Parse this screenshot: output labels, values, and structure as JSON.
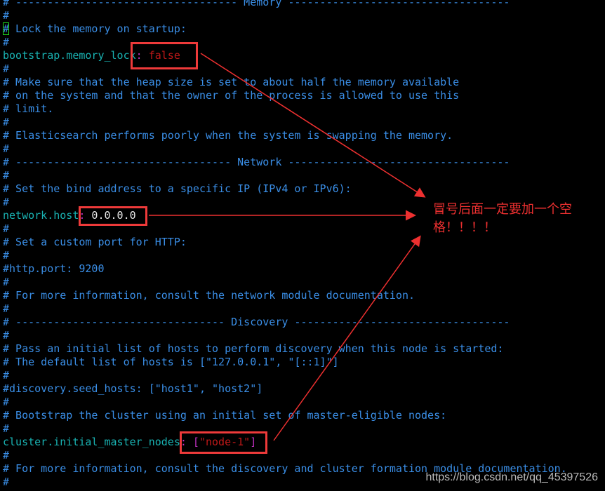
{
  "lines": [
    [
      [
        "c",
        "# ----------------------------------- Memory -----------------------------------"
      ]
    ],
    [
      [
        "c",
        "#"
      ]
    ],
    [
      [
        "c cursor",
        "#"
      ],
      [
        "c",
        " Lock the memory on startup:"
      ]
    ],
    [
      [
        "c",
        "#"
      ]
    ],
    [
      [
        "k",
        "bootstrap.memory_lock"
      ],
      [
        "p",
        ":"
      ],
      [
        "s",
        " false"
      ]
    ],
    [
      [
        "c",
        "#"
      ]
    ],
    [
      [
        "c",
        "# Make sure that the heap size is set to about half the memory available"
      ]
    ],
    [
      [
        "c",
        "# on the system and that the owner of the process is allowed to use this"
      ]
    ],
    [
      [
        "c",
        "# limit."
      ]
    ],
    [
      [
        "c",
        "#"
      ]
    ],
    [
      [
        "c",
        "# Elasticsearch performs poorly when the system is swapping the memory."
      ]
    ],
    [
      [
        "c",
        "#"
      ]
    ],
    [
      [
        "c",
        "# ---------------------------------- Network -----------------------------------"
      ]
    ],
    [
      [
        "c",
        "#"
      ]
    ],
    [
      [
        "c",
        "# Set the bind address to a specific IP (IPv4 or IPv6):"
      ]
    ],
    [
      [
        "c",
        "#"
      ]
    ],
    [
      [
        "k",
        "network.host"
      ],
      [
        "p",
        ":"
      ],
      [
        "v",
        " 0.0.0.0"
      ]
    ],
    [
      [
        "c",
        "#"
      ]
    ],
    [
      [
        "c",
        "# Set a custom port for HTTP:"
      ]
    ],
    [
      [
        "c",
        "#"
      ]
    ],
    [
      [
        "c",
        "#http.port: 9200"
      ]
    ],
    [
      [
        "c",
        "#"
      ]
    ],
    [
      [
        "c",
        "# For more information, consult the network module documentation."
      ]
    ],
    [
      [
        "c",
        "#"
      ]
    ],
    [
      [
        "c",
        "# --------------------------------- Discovery ----------------------------------"
      ]
    ],
    [
      [
        "c",
        "#"
      ]
    ],
    [
      [
        "c",
        "# Pass an initial list of hosts to perform discovery when this node is started:"
      ]
    ],
    [
      [
        "c",
        "# The default list of hosts is [\"127.0.0.1\", \"[::1]\"]"
      ]
    ],
    [
      [
        "c",
        "#"
      ]
    ],
    [
      [
        "c",
        "#discovery.seed_hosts: [\"host1\", \"host2\"]"
      ]
    ],
    [
      [
        "c",
        "#"
      ]
    ],
    [
      [
        "c",
        "# Bootstrap the cluster using an initial set of master-eligible nodes:"
      ]
    ],
    [
      [
        "c",
        "#"
      ]
    ],
    [
      [
        "k",
        "cluster.initial_master_nodes"
      ],
      [
        "p",
        ":"
      ],
      [
        "p",
        " ["
      ],
      [
        "s",
        "\"node-1\""
      ],
      [
        "p",
        "]"
      ]
    ],
    [
      [
        "c",
        "#"
      ]
    ],
    [
      [
        "c",
        "# For more information, consult the discovery and cluster formation module documentation."
      ]
    ],
    [
      [
        "c",
        "#"
      ]
    ]
  ],
  "annotation": {
    "note": "冒号后面一定要加一个空格！！！！",
    "color": "#ee3030"
  },
  "watermark": "https://blog.csdn.net/qq_45397526",
  "colors": {
    "comment": "#3a8ee6",
    "key": "#19b3b3",
    "punct": "#c030c0",
    "string": "#c01818",
    "background": "#000000"
  }
}
